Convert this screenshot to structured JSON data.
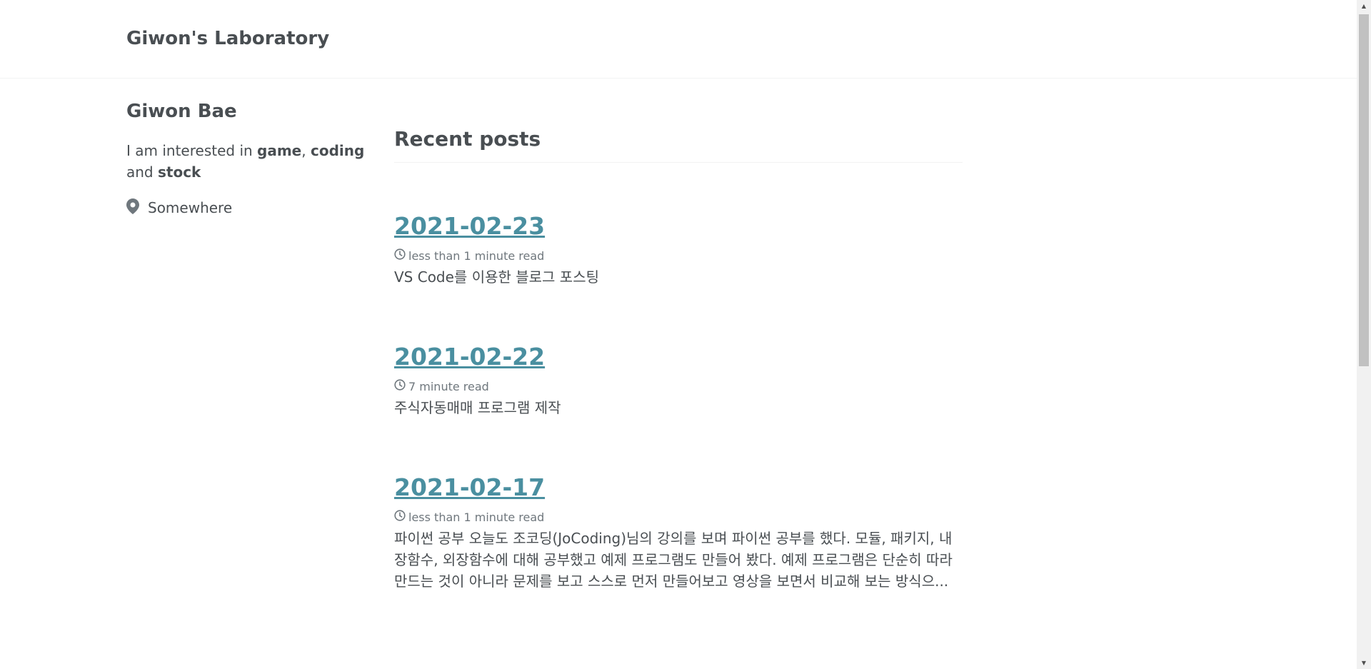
{
  "header": {
    "site_title": "Giwon's Laboratory"
  },
  "sidebar": {
    "author_name": "Giwon Bae",
    "bio": {
      "prefix": "I am interested in ",
      "word1": "game",
      "sep1": ", ",
      "word2": "coding",
      "sep2": " and ",
      "word3": "stock"
    },
    "location": "Somewhere"
  },
  "main": {
    "section_title": "Recent posts",
    "posts": [
      {
        "title": "2021-02-23",
        "read_time": "less than 1 minute read",
        "excerpt": "VS Code를 이용한 블로그 포스팅"
      },
      {
        "title": "2021-02-22",
        "read_time": "7 minute read",
        "excerpt": "주식자동매매 프로그램 제작"
      },
      {
        "title": "2021-02-17",
        "read_time": "less than 1 minute read",
        "excerpt": "파이썬 공부 오늘도 조코딩(JoCoding)님의 강의를 보며 파이썬 공부를 했다. 모듈, 패키지, 내장함수, 외장함수에 대해 공부했고 예제 프로그램도 만들어 봤다. 예제 프로그램은 단순히 따라 만드는 것이 아니라 문제를 보고 스스로 먼저 만들어보고 영상을 보면서 비교해 보는 방식으..."
      }
    ]
  },
  "icons": {
    "location": "map-marker-icon",
    "clock": "clock-icon"
  },
  "colors": {
    "link": "#4a8fa0",
    "text": "#494e52",
    "meta": "#6f777d"
  }
}
